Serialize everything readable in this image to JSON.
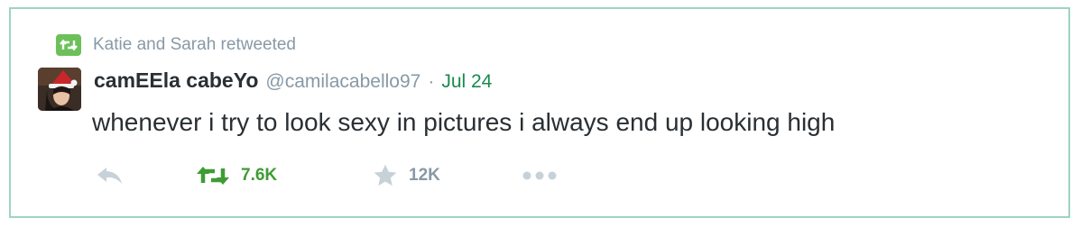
{
  "retweet_context": {
    "text": "Katie and Sarah retweeted",
    "icon": "retweet-icon"
  },
  "tweet": {
    "fullname": "camEEla cabeYo",
    "username": "@camilacabello97",
    "separator": "·",
    "timestamp": "Jul 24",
    "text": "whenever i try to look sexy in pictures i always end up looking high",
    "avatar_icon": "avatar"
  },
  "actions": {
    "reply_icon": "reply-icon",
    "retweet_icon": "retweet-icon",
    "retweet_count": "7.6K",
    "favorite_icon": "star-icon",
    "favorite_count": "12K",
    "more_icon": "more-dots-icon"
  },
  "colors": {
    "retweet_green": "#3f9c35",
    "timestamp_green": "#1a8a4e",
    "muted_gray": "#8899a6",
    "text_dark": "#292f33",
    "border": "#9fd3c2"
  }
}
